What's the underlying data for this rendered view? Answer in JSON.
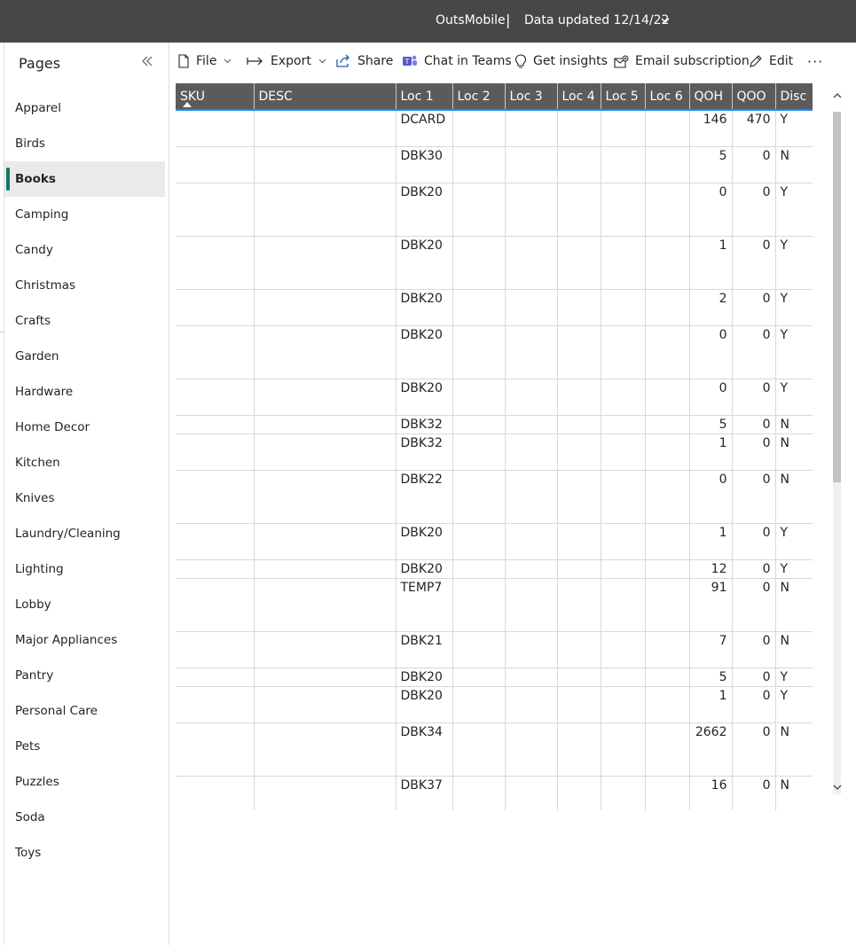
{
  "topbar": {
    "workspace": "OutsMobile",
    "separator": "|",
    "updated": "Data updated 12/14/22"
  },
  "pages": {
    "title": "Pages",
    "items": [
      {
        "label": "Apparel"
      },
      {
        "label": "Birds"
      },
      {
        "label": "Books",
        "active": true
      },
      {
        "label": "Camping"
      },
      {
        "label": "Candy"
      },
      {
        "label": "Christmas"
      },
      {
        "label": "Crafts"
      },
      {
        "label": "Garden"
      },
      {
        "label": "Hardware"
      },
      {
        "label": "Home Decor"
      },
      {
        "label": "Kitchen"
      },
      {
        "label": "Knives"
      },
      {
        "label": "Laundry/Cleaning"
      },
      {
        "label": "Lighting"
      },
      {
        "label": "Lobby"
      },
      {
        "label": "Major Appliances"
      },
      {
        "label": "Pantry"
      },
      {
        "label": "Personal Care"
      },
      {
        "label": "Pets"
      },
      {
        "label": "Puzzles"
      },
      {
        "label": "Soda"
      },
      {
        "label": "Toys"
      }
    ]
  },
  "toolbar": {
    "file": "File",
    "export": "Export",
    "share": "Share",
    "chat": "Chat in Teams",
    "insights": "Get insights",
    "email": "Email subscription",
    "edit": "Edit",
    "more": "···"
  },
  "table": {
    "columns": [
      "SKU",
      "DESC",
      "Loc 1",
      "Loc 2",
      "Loc 3",
      "Loc 4",
      "Loc 5",
      "Loc 6",
      "QOH",
      "QOO",
      "Disc"
    ],
    "sorted_column": "SKU",
    "rows": [
      {
        "sku": "",
        "desc": "",
        "loc1": "DCARD",
        "qoh": "146",
        "qoo": "470",
        "disc": "Y",
        "lines": 2
      },
      {
        "sku": "",
        "desc": "",
        "loc1": "DBK30",
        "qoh": "5",
        "qoo": "0",
        "disc": "N",
        "lines": 2
      },
      {
        "sku": "",
        "desc": "",
        "loc1": "DBK20",
        "qoh": "0",
        "qoo": "0",
        "disc": "Y",
        "lines": 3
      },
      {
        "sku": "",
        "desc": "",
        "loc1": "DBK20",
        "qoh": "1",
        "qoo": "0",
        "disc": "Y",
        "lines": 3
      },
      {
        "sku": "",
        "desc": "",
        "loc1": "DBK20",
        "qoh": "2",
        "qoo": "0",
        "disc": "Y",
        "lines": 2
      },
      {
        "sku": "",
        "desc": "",
        "loc1": "DBK20",
        "qoh": "0",
        "qoo": "0",
        "disc": "Y",
        "lines": 3
      },
      {
        "sku": "",
        "desc": "",
        "loc1": "DBK20",
        "qoh": "0",
        "qoo": "0",
        "disc": "Y",
        "lines": 2
      },
      {
        "sku": "",
        "desc": "",
        "loc1": "DBK32",
        "qoh": "5",
        "qoo": "0",
        "disc": "N",
        "lines": 1
      },
      {
        "sku": "",
        "desc": "",
        "loc1": "DBK32",
        "qoh": "1",
        "qoo": "0",
        "disc": "N",
        "lines": 2
      },
      {
        "sku": "",
        "desc": "",
        "loc1": "DBK22",
        "qoh": "0",
        "qoo": "0",
        "disc": "N",
        "lines": 3
      },
      {
        "sku": "",
        "desc": "",
        "loc1": "DBK20",
        "qoh": "1",
        "qoo": "0",
        "disc": "Y",
        "lines": 2
      },
      {
        "sku": "",
        "desc": "",
        "loc1": "DBK20",
        "qoh": "12",
        "qoo": "0",
        "disc": "Y",
        "lines": 1
      },
      {
        "sku": "",
        "desc": "",
        "loc1": "TEMP7",
        "qoh": "91",
        "qoo": "0",
        "disc": "N",
        "lines": 3
      },
      {
        "sku": "",
        "desc": "",
        "loc1": "DBK21",
        "qoh": "7",
        "qoo": "0",
        "disc": "N",
        "lines": 2
      },
      {
        "sku": "",
        "desc": "",
        "loc1": "DBK20",
        "qoh": "5",
        "qoo": "0",
        "disc": "Y",
        "lines": 1
      },
      {
        "sku": "",
        "desc": "",
        "loc1": "DBK20",
        "qoh": "1",
        "qoo": "0",
        "disc": "Y",
        "lines": 2
      },
      {
        "sku": "",
        "desc": "",
        "loc1": "DBK34",
        "qoh": "2662",
        "qoo": "0",
        "disc": "N",
        "lines": 3
      },
      {
        "sku": "",
        "desc": "",
        "loc1": "DBK37",
        "qoh": "16",
        "qoo": "0",
        "disc": "N",
        "lines": 2
      }
    ]
  },
  "colors": {
    "topbar_bg": "#474747",
    "header_bg": "#5b5b5b",
    "active_accent": "#117865",
    "sort_underline": "#118dff"
  }
}
